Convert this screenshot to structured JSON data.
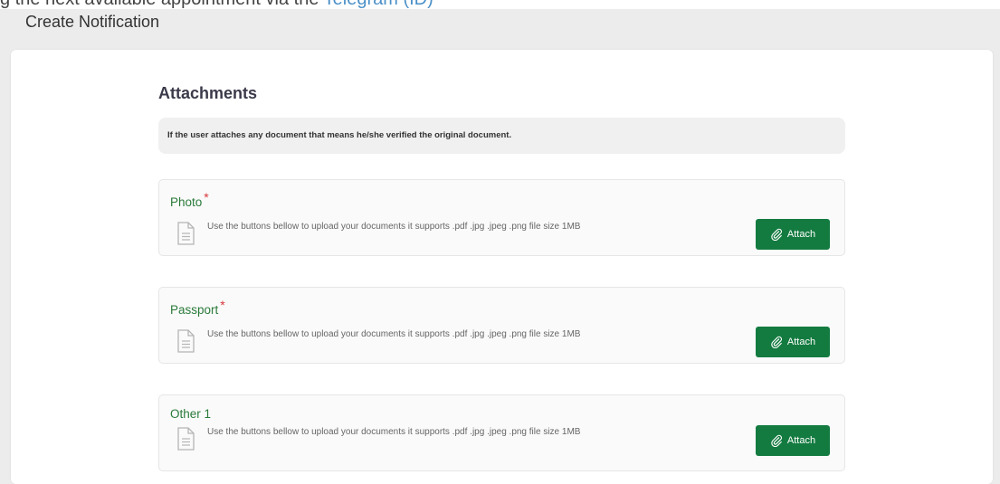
{
  "top_cut": {
    "text": "g the next available appointment via the ",
    "link": "Telegram (ID)"
  },
  "page": {
    "title": "Create Notification"
  },
  "attachments": {
    "heading": "Attachments",
    "notice": "If the user attaches any document that means he/she verified the original document.",
    "items": [
      {
        "label": "Photo",
        "required": "*",
        "description": "Use the buttons bellow to upload your documents it supports .pdf .jpg .jpeg .png file size 1MB",
        "button": "Attach"
      },
      {
        "label": "Passport",
        "required": "*",
        "description": "Use the buttons bellow to upload your documents it supports .pdf .jpg .jpeg .png file size 1MB",
        "button": "Attach"
      },
      {
        "label": "Other 1",
        "required": "",
        "description": "Use the buttons bellow to upload your documents it supports .pdf .jpg .jpeg .png file size 1MB",
        "button": "Attach"
      }
    ]
  },
  "colors": {
    "accent_green": "#137b40",
    "label_green": "#2a7a3a",
    "required_red": "#d9383a"
  },
  "icons": {
    "document": "document-icon",
    "attach": "paperclip-icon"
  }
}
